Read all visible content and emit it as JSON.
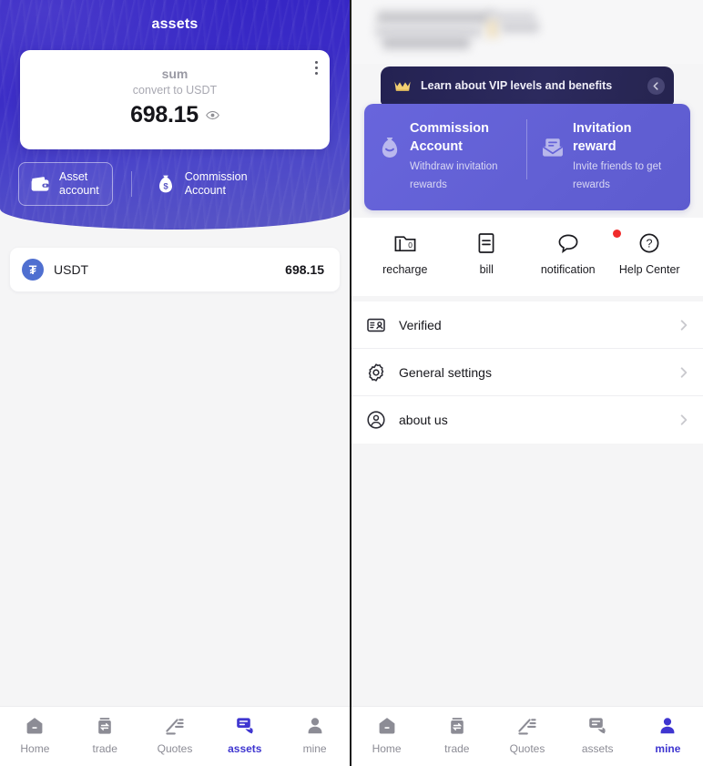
{
  "colors": {
    "hero_purple_top": "#3322c4",
    "hero_purple_bottom": "#5a57c4",
    "promo_purple": "#6865dc",
    "vip_navy": "#242252",
    "accent_active": "#3f36d0",
    "tab_inactive": "#8c8c95",
    "badge_red": "#f02b2b",
    "page_bg": "#f5f5f6",
    "usdt_blue": "#4f6fd0",
    "crown_gold": "#f2cf72"
  },
  "left_panel": {
    "header_title": "assets",
    "balance_card": {
      "menu_icon": "more-vertical-icon",
      "sum_label": "sum",
      "convert_label": "convert to USDT",
      "amount": "698.15",
      "visibility_icon": "eye-icon"
    },
    "account_tabs": [
      {
        "label_line1": "Asset",
        "label_line2": "account",
        "icon": "wallet-icon",
        "selected": true
      },
      {
        "label_line1": "Commission",
        "label_line2": "Account",
        "icon": "money-bag-icon",
        "selected": false
      }
    ],
    "coins": [
      {
        "symbol": "USDT",
        "icon": "usdt-coin-icon",
        "glyph": "₮",
        "amount": "698.15"
      }
    ],
    "tabbar": [
      {
        "label": "Home",
        "icon": "home-icon",
        "active": false
      },
      {
        "label": "trade",
        "icon": "trade-icon",
        "active": false
      },
      {
        "label": "Quotes",
        "icon": "quotes-icon",
        "active": false
      },
      {
        "label": "assets",
        "icon": "assets-icon",
        "active": true
      },
      {
        "label": "mine",
        "icon": "person-icon",
        "active": false
      }
    ]
  },
  "right_panel": {
    "profile": {
      "redacted": true,
      "note": ""
    },
    "vip_banner": {
      "icon": "crown-icon",
      "text": "Learn about VIP levels and benefits",
      "arrow_icon": "chevron-left-circle-icon"
    },
    "promo_cards": [
      {
        "icon": "money-bag-icon",
        "title_line1": "Commission",
        "title_line2": "Account",
        "desc_line1": "Withdraw invitation",
        "desc_line2": "rewards"
      },
      {
        "icon": "envelope-icon",
        "title_line1": "Invitation",
        "title_line2": "reward",
        "desc_line1": "Invite friends to get",
        "desc_line2": "rewards"
      }
    ],
    "quick_actions": [
      {
        "label": "recharge",
        "icon": "recharge-icon",
        "badge": false
      },
      {
        "label": "bill",
        "icon": "bill-icon",
        "badge": false
      },
      {
        "label": "notification",
        "icon": "notification-icon",
        "badge": true
      },
      {
        "label": "Help Center",
        "icon": "help-circle-icon",
        "badge": false
      }
    ],
    "settings": [
      {
        "label": "Verified",
        "icon": "id-card-icon",
        "chevron": "chevron-right-icon"
      },
      {
        "label": "General settings",
        "icon": "gear-icon",
        "chevron": "chevron-right-icon"
      },
      {
        "label": "about us",
        "icon": "user-circle-icon",
        "chevron": "chevron-right-icon"
      }
    ],
    "tabbar": [
      {
        "label": "Home",
        "icon": "home-icon",
        "active": false
      },
      {
        "label": "trade",
        "icon": "trade-icon",
        "active": false
      },
      {
        "label": "Quotes",
        "icon": "quotes-icon",
        "active": false
      },
      {
        "label": "assets",
        "icon": "assets-icon",
        "active": false
      },
      {
        "label": "mine",
        "icon": "person-icon",
        "active": true
      }
    ]
  }
}
